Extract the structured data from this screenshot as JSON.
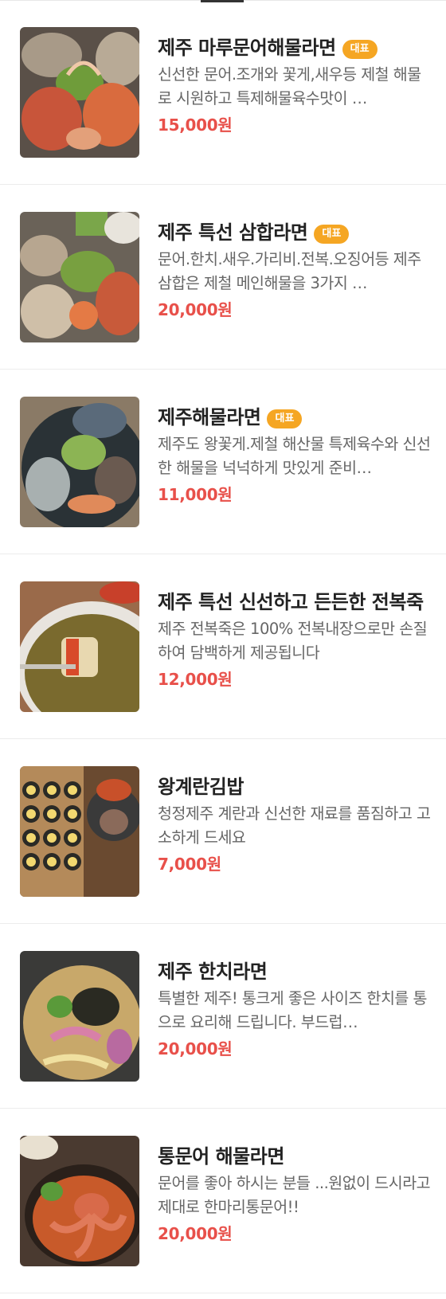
{
  "menu": {
    "badge_label": "대표",
    "items": [
      {
        "name": "제주 마루문어해물라면",
        "description": "신선한 문어.조개와 꽃게,새우등 제철 해물로 시원하고 특제해물육수맛이 …",
        "price": "15,000원",
        "photo_icon": "seafood-ramen-photo",
        "featured": true
      },
      {
        "name": "제주 특선 삼합라면",
        "description": "문어.한치.새우.가리비.전복.오징어등 제주삼합은 제철 메인해물을 3가지 …",
        "price": "20,000원",
        "photo_icon": "samhap-ramen-photo",
        "featured": true
      },
      {
        "name": "제주해물라면",
        "description": "제주도 왕꽃게.제철 해산물 특제육수와 신선한 해물을 넉넉하게 맛있게 준비…",
        "price": "11,000원",
        "photo_icon": "seafood-ramen-bowl-photo",
        "featured": true
      },
      {
        "name": "제주 특선 신선하고 든든한 전복죽",
        "description": "제주 전복죽은 100% 전복내장으로만 손질하여 담백하게 제공됩니다",
        "price": "12,000원",
        "photo_icon": "abalone-porridge-photo",
        "featured": false
      },
      {
        "name": "왕계란김밥",
        "description": "청정제주 계란과 신선한 재료를 품짐하고 고소하게 드세요",
        "price": "7,000원",
        "photo_icon": "gimbap-photo",
        "featured": false
      },
      {
        "name": "제주 한치라면",
        "description": "특별한 제주! 통크게 좋은 사이즈 한치를 통으로 요리해 드립니다. 부드럽…",
        "price": "20,000원",
        "photo_icon": "squid-ramen-photo",
        "featured": false
      },
      {
        "name": "통문어 해물라면",
        "description": "문어를 좋아 하시는 분들 ...원없이 드시라고 제대로 한마리통문어!!",
        "price": "20,000원",
        "photo_icon": "whole-octopus-ramen-photo",
        "featured": false
      }
    ]
  },
  "colors": {
    "price": "#e8504a",
    "badge": "#f5a623",
    "title": "#222222",
    "description": "#666666"
  }
}
